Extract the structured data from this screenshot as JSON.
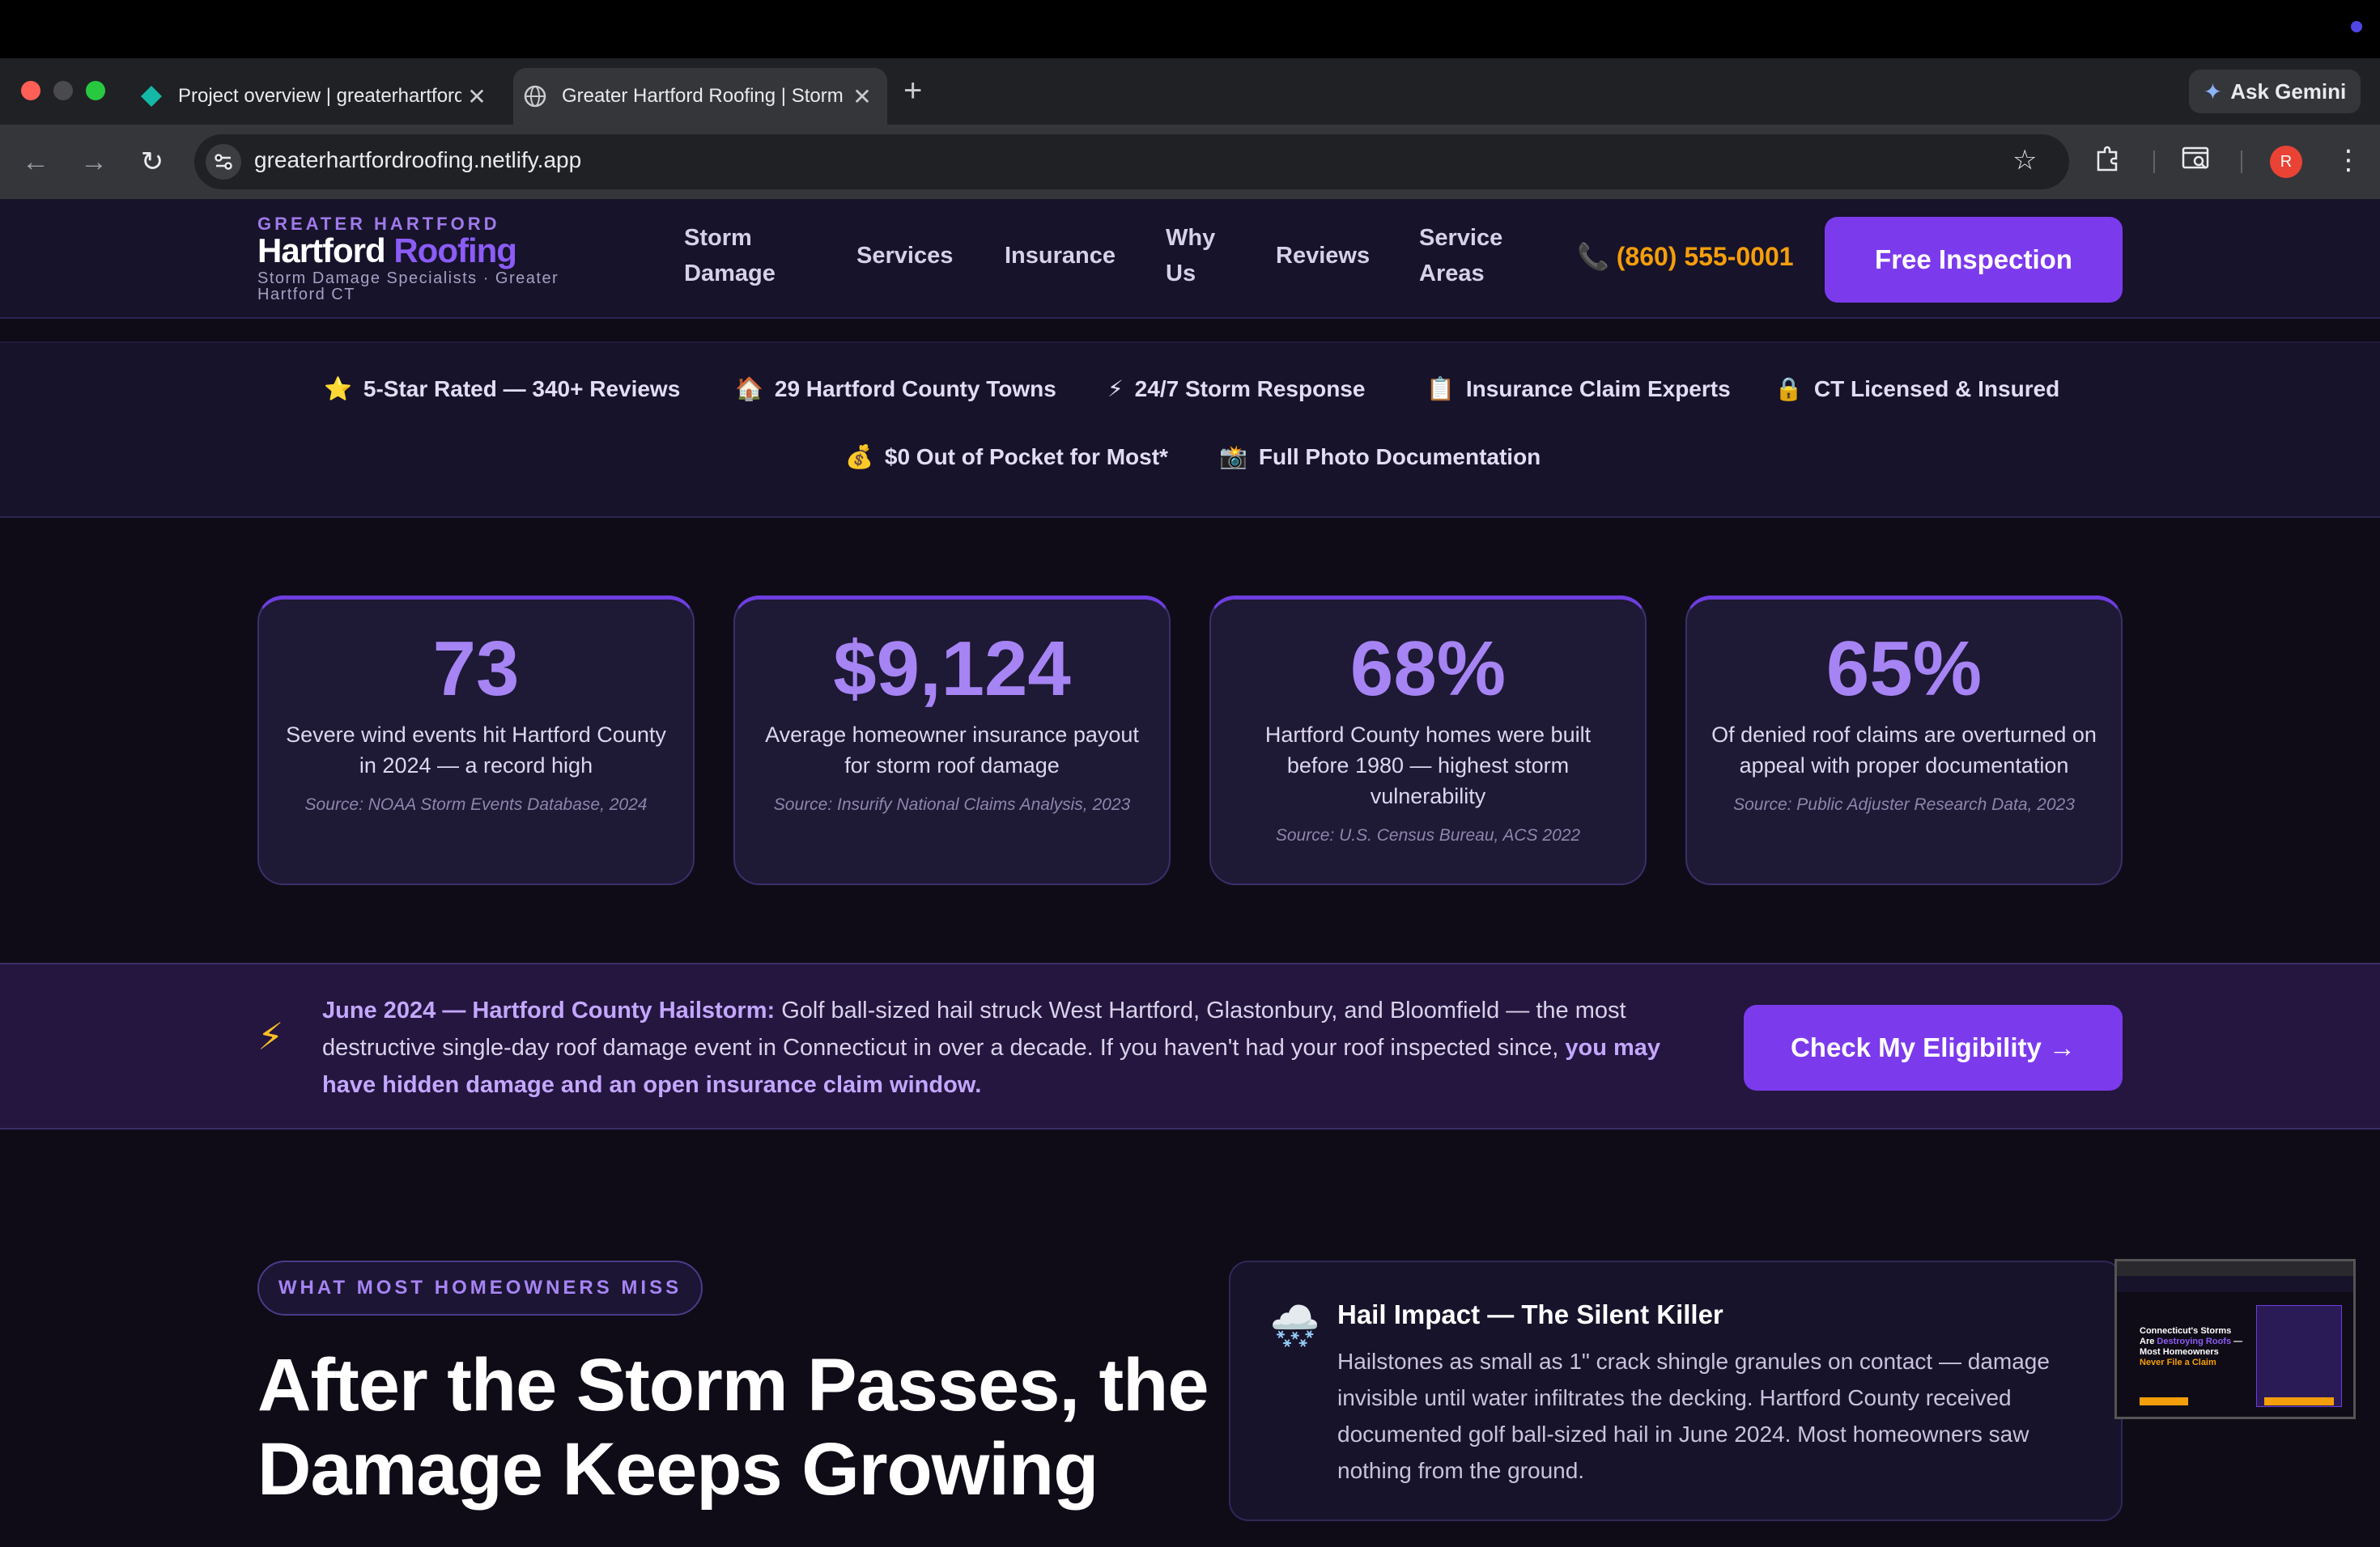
{
  "browser": {
    "tabs": [
      {
        "title": "Project overview | greaterhartfordroofing"
      },
      {
        "title": "Greater Hartford Roofing | Storm Damage Specialists"
      }
    ],
    "new_tab": "+",
    "close_glyph": "✕",
    "ask_gemini": "Ask Gemini",
    "url": "greaterhartfordroofing.netlify.app",
    "avatar_initial": "R"
  },
  "site": {
    "brand": {
      "eyebrow": "GREATER HARTFORD",
      "name_main": "Hartford",
      "name_accent": "Roofing",
      "tagline": "Storm Damage Specialists · Greater Hartford CT"
    },
    "nav": {
      "storm_damage": "Storm Damage",
      "services": "Services",
      "insurance": "Insurance",
      "why_us": "Why Us",
      "reviews": "Reviews",
      "service_areas": "Service Areas"
    },
    "phone": "(860) 555-0001",
    "cta": "Free Inspection"
  },
  "trust": [
    {
      "icon": "⭐",
      "text": "5-Star Rated — 340+ Reviews"
    },
    {
      "icon": "🏠",
      "text": "29 Hartford County Towns"
    },
    {
      "icon": "⚡",
      "text": "24/7 Storm Response"
    },
    {
      "icon": "📋",
      "text": "Insurance Claim Experts"
    },
    {
      "icon": "🔒",
      "text": "CT Licensed & Insured"
    },
    {
      "icon": "💰",
      "text": "$0 Out of Pocket for Most*"
    },
    {
      "icon": "📸",
      "text": "Full Photo Documentation"
    }
  ],
  "stats": [
    {
      "value": "73",
      "desc": "Severe wind events hit Hartford County in 2024 — a record high",
      "source": "Source: NOAA Storm Events Database, 2024"
    },
    {
      "value": "$9,124",
      "desc": "Average homeowner insurance payout for storm roof damage",
      "source": "Source: Insurify National Claims Analysis, 2023"
    },
    {
      "value": "68%",
      "desc": "Hartford County homes were built before 1980 — highest storm vulnerability",
      "source": "Source: U.S. Census Bureau, ACS 2022"
    },
    {
      "value": "65%",
      "desc": "Of denied roof claims are overturned on appeal with proper documentation",
      "source": "Source: Public Adjuster Research Data, 2023"
    }
  ],
  "alert": {
    "highlight": "June 2024 — Hartford County Hailstorm:",
    "body": " Golf ball-sized hail struck West Hartford, Glastonbury, and Bloomfield — the most destructive single-day roof damage event in Connecticut in over a decade. If you haven't had your roof inspected since, ",
    "emphasis": "you may have hidden damage and an open insurance claim window.",
    "button": "Check My Eligibility →"
  },
  "section": {
    "eyebrow": "WHAT MOST HOMEOWNERS MISS",
    "heading": "After the Storm Passes, the Damage Keeps Growing"
  },
  "info_card": {
    "icon": "🌨️",
    "title": "Hail Impact — The Silent Killer",
    "body": "Hailstones as small as 1\" crack shingle granules on contact — damage invisible until water infiltrates the decking. Hartford County received documented golf ball-sized hail in June 2024. Most homeowners saw nothing from the ground."
  },
  "thumbnail": {
    "line1": "Connecticut's Storms",
    "line2_pre": "Are ",
    "line2_accent": "Destroying Roofs",
    "line2_post": " —",
    "line3": "Most Homeowners",
    "line4": "Never File a Claim"
  }
}
